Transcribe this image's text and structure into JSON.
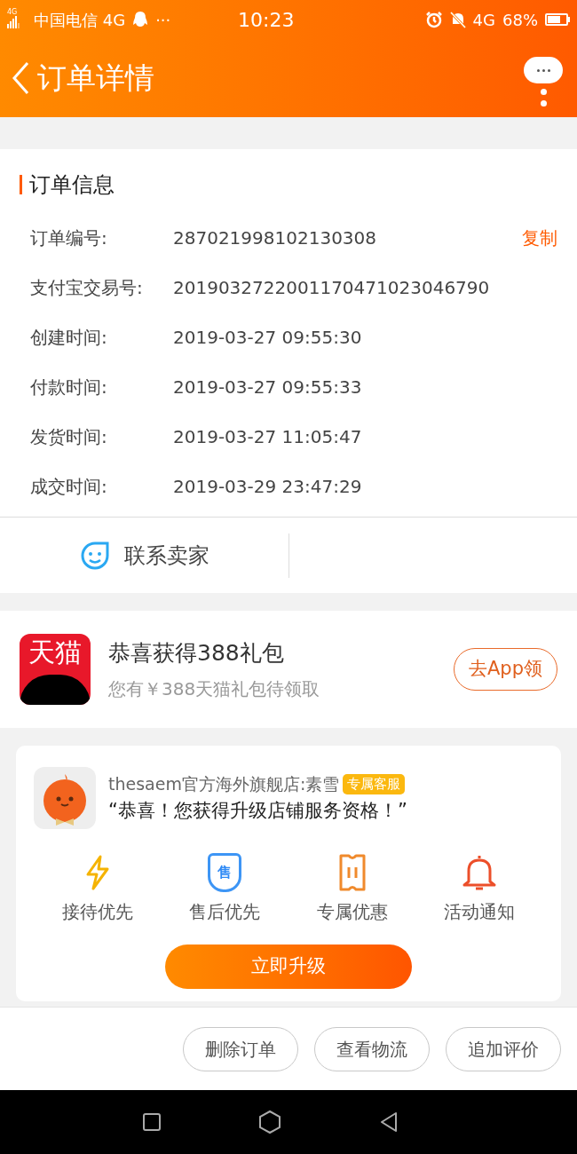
{
  "status_bar": {
    "network_badge": "4G",
    "carrier": "中国电信 4G",
    "more": "···",
    "time": "10:23",
    "network": "4G",
    "battery": "68%"
  },
  "header": {
    "title": "订单详情"
  },
  "order_info": {
    "title": "订单信息",
    "rows": [
      {
        "label": "订单编号:",
        "value": "287021998102130308",
        "action": "复制"
      },
      {
        "label": "支付宝交易号:",
        "value": "2019032722001170471023046790"
      },
      {
        "label": "创建时间:",
        "value": "2019-03-27 09:55:30"
      },
      {
        "label": "付款时间:",
        "value": "2019-03-27 09:55:33"
      },
      {
        "label": "发货时间:",
        "value": "2019-03-27 11:05:47"
      },
      {
        "label": "成交时间:",
        "value": "2019-03-29 23:47:29"
      }
    ],
    "contact": "联系卖家"
  },
  "promo": {
    "logo_text": "天猫",
    "title": "恭喜获得388礼包",
    "subtitle": "您有￥388天猫礼包待领取",
    "button": "去App领"
  },
  "store": {
    "name": "thesaem官方海外旗舰店:素雪",
    "badge": "专属客服",
    "message": "“恭喜！您获得升级店铺服务资格！”",
    "benefits": [
      {
        "kind": "bolt",
        "label": "接待优先"
      },
      {
        "kind": "shield",
        "label": "售后优先",
        "icon_text": "售"
      },
      {
        "kind": "ticket",
        "label": "专属优惠"
      },
      {
        "kind": "bell",
        "label": "活动通知"
      }
    ],
    "button": "立即升级"
  },
  "actions": [
    "删除订单",
    "查看物流",
    "追加评价"
  ]
}
